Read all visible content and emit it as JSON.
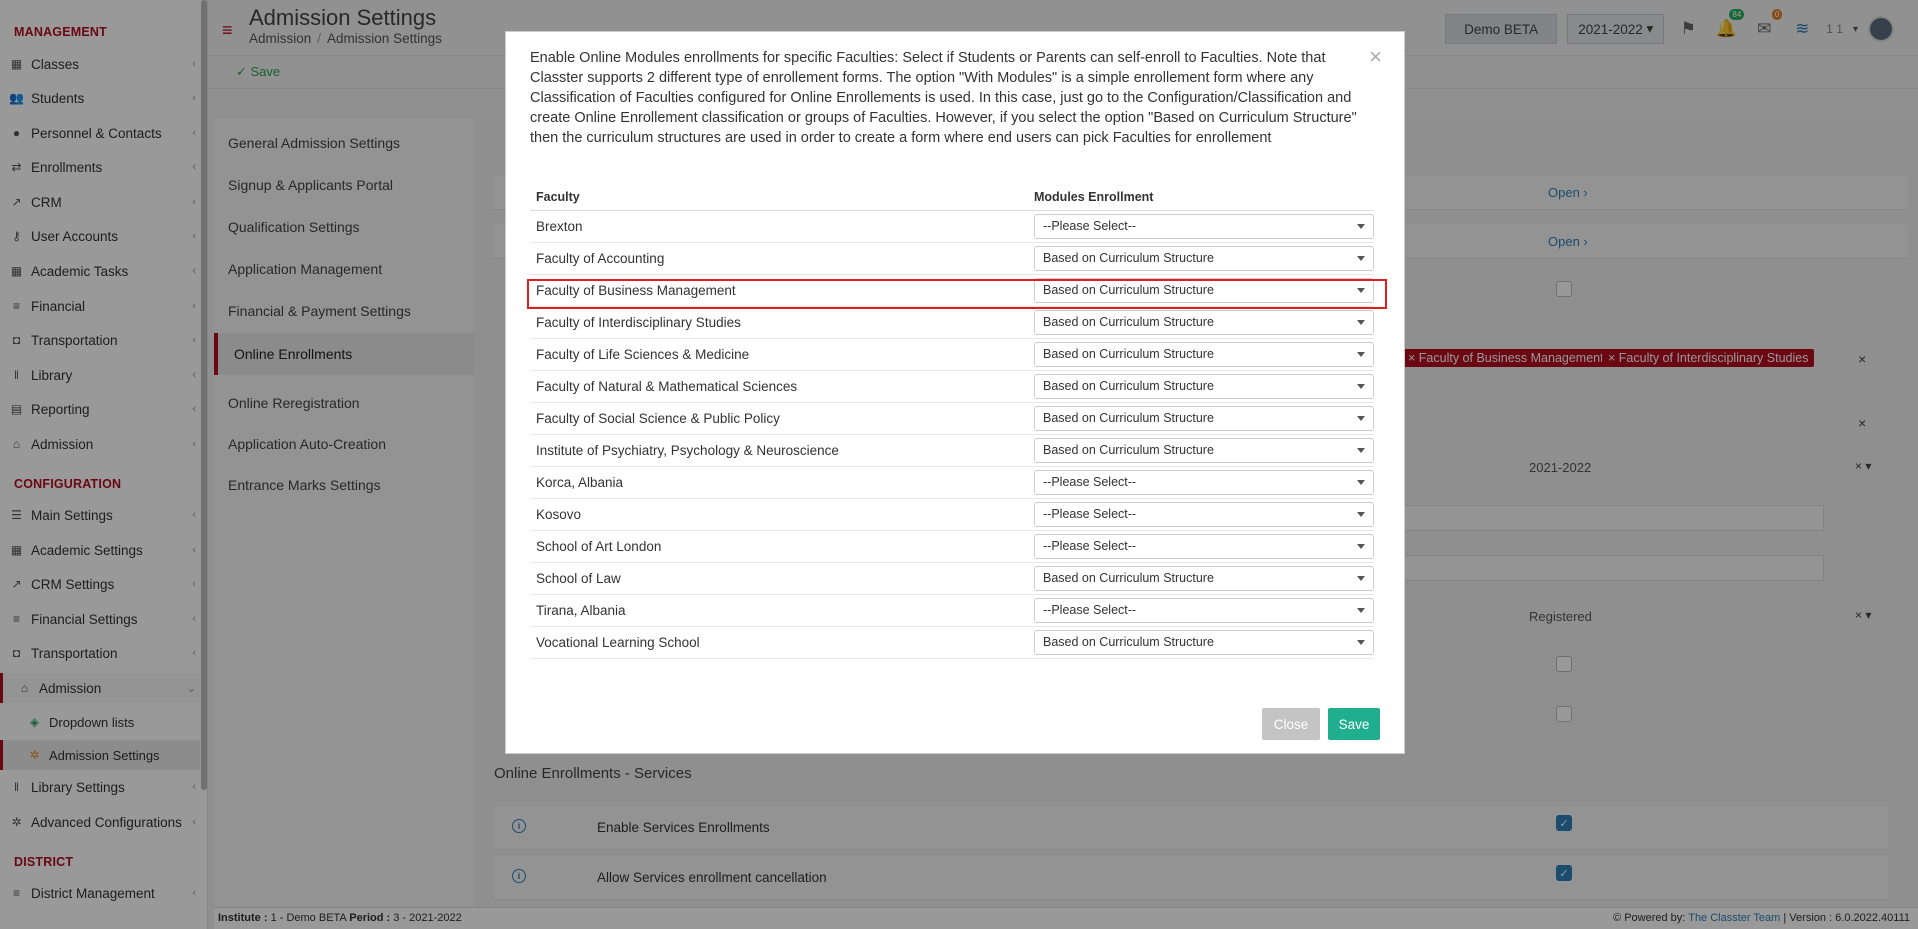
{
  "sidebar": {
    "management_title": "MANAGEMENT",
    "management_items": [
      {
        "label": "Classes",
        "icon": "classes-icon"
      },
      {
        "label": "Students",
        "icon": "students-icon"
      },
      {
        "label": "Personnel & Contacts",
        "icon": "personnel-icon"
      },
      {
        "label": "Enrollments",
        "icon": "enrollments-icon"
      },
      {
        "label": "CRM",
        "icon": "crm-icon"
      },
      {
        "label": "User Accounts",
        "icon": "user-accounts-icon"
      },
      {
        "label": "Academic Tasks",
        "icon": "academic-tasks-icon"
      },
      {
        "label": "Financial",
        "icon": "financial-icon"
      },
      {
        "label": "Transportation",
        "icon": "transportation-icon"
      },
      {
        "label": "Library",
        "icon": "library-icon"
      },
      {
        "label": "Reporting",
        "icon": "reporting-icon"
      },
      {
        "label": "Admission",
        "icon": "admission-icon"
      }
    ],
    "configuration_title": "CONFIGURATION",
    "configuration_items": [
      {
        "label": "Main Settings"
      },
      {
        "label": "Academic Settings"
      },
      {
        "label": "CRM Settings"
      },
      {
        "label": "Financial Settings"
      },
      {
        "label": "Transportation"
      },
      {
        "label": "Admission"
      },
      {
        "label": "Dropdown lists"
      },
      {
        "label": "Admission Settings"
      },
      {
        "label": "Library Settings"
      },
      {
        "label": "Advanced Configurations"
      }
    ],
    "district_title": "DISTRICT",
    "district_items": [
      {
        "label": "District Management"
      }
    ]
  },
  "header": {
    "title": "Admission Settings",
    "breadcrumb": [
      "Admission",
      "Admission Settings"
    ],
    "institute_button": "Demo BETA",
    "period": "2021-2022",
    "notifications_count": "84",
    "messages_count": "0",
    "user_label": "1 1"
  },
  "toolbar": {
    "save_label": "Save"
  },
  "settings_nav": [
    "General Admission Settings",
    "Signup & Applicants Portal",
    "Qualification Settings",
    "Application Management",
    "Financial & Payment Settings",
    "Online Enrollments",
    "Online Reregistration",
    "Application Auto-Creation",
    "Entrance Marks Settings"
  ],
  "background": {
    "open_label": "Open",
    "tags": [
      "Faculty of Business Management",
      "Faculty of Interdisciplinary Studies"
    ],
    "year_value": "2021-2022",
    "status_value": "Registered",
    "services_title": "Online Enrollments - Services",
    "services": [
      {
        "label": "Enable Services Enrollments",
        "checked": true
      },
      {
        "label": "Allow Services enrollment cancellation",
        "checked": true
      }
    ]
  },
  "footer": {
    "institute_label": "Institute :",
    "institute_value": "1 - Demo BETA",
    "period_label": "Period :",
    "period_value": "3 - 2021-2022",
    "powered_by": "Powered by:",
    "team": "The Classter Team",
    "version": "| Version : 6.0.2022.40111"
  },
  "modal": {
    "description": "Enable Online Modules enrollments for specific Faculties: Select if Students or Parents can self-enroll to Faculties. Note that Classter supports 2 different type of enrollement forms. The option \"With Modules\" is a simple enrollement form where any Classification of Faculties configured for Online Enrollements is used. In this case, just go to the Configuration/Classification and create Online Enrollement classification or groups of Faculties. However, if you select the option \"Based on Curriculum Structure\" then the curriculum structures are used in order to create a form where end users can pick Faculties for enrollement",
    "col_faculty": "Faculty",
    "col_enrollment": "Modules Enrollment",
    "rows": [
      {
        "faculty": "Brexton",
        "value": "--Please Select--"
      },
      {
        "faculty": "Faculty of Accounting",
        "value": "Based on Curriculum Structure"
      },
      {
        "faculty": "Faculty of Business Management",
        "value": "Based on Curriculum Structure"
      },
      {
        "faculty": "Faculty of Interdisciplinary Studies",
        "value": "Based on Curriculum Structure"
      },
      {
        "faculty": "Faculty of Life Sciences & Medicine",
        "value": "Based on Curriculum Structure"
      },
      {
        "faculty": "Faculty of Natural & Mathematical Sciences",
        "value": "Based on Curriculum Structure"
      },
      {
        "faculty": "Faculty of Social Science & Public Policy",
        "value": "Based on Curriculum Structure"
      },
      {
        "faculty": "Institute of Psychiatry, Psychology & Neuroscience",
        "value": "Based on Curriculum Structure"
      },
      {
        "faculty": "Korca, Albania",
        "value": "--Please Select--"
      },
      {
        "faculty": "Kosovo",
        "value": "--Please Select--"
      },
      {
        "faculty": "School of Art London",
        "value": "--Please Select--"
      },
      {
        "faculty": "School of Law",
        "value": "Based on Curriculum Structure"
      },
      {
        "faculty": "Tirana, Albania",
        "value": "--Please Select--"
      },
      {
        "faculty": "Vocational Learning School",
        "value": "Based on Curriculum Structure"
      }
    ],
    "close_label": "Close",
    "save_label": "Save"
  },
  "colors": {
    "brand_red": "#b10d1f",
    "save_green": "#1fae8e",
    "highlight_red": "#e02020"
  }
}
